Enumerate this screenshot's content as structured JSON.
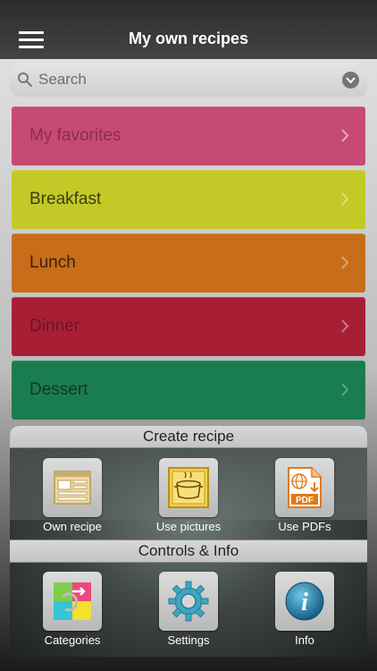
{
  "header": {
    "title": "My own recipes",
    "menu_icon": "hamburger-menu-icon"
  },
  "search": {
    "placeholder": "Search",
    "icon": "search-icon",
    "dropdown_icon": "chevron-down-circle-icon"
  },
  "categories": [
    {
      "label": "My favorites",
      "color": "#c74a74",
      "text_color": "#8a2d4f"
    },
    {
      "label": "Breakfast",
      "color": "#c3c926",
      "text_color": "#3d3d10"
    },
    {
      "label": "Lunch",
      "color": "#c86d1a",
      "text_color": "#3a2208"
    },
    {
      "label": "Dinner",
      "color": "#a81f35",
      "text_color": "#6e1222"
    },
    {
      "label": "Dessert",
      "color": "#1a7d4f",
      "text_color": "#0f3a25"
    }
  ],
  "create_section": {
    "title": "Create recipe",
    "items": [
      {
        "label": "Own recipe",
        "icon": "recipe-form-icon"
      },
      {
        "label": "Use pictures",
        "icon": "cooking-pot-icon"
      },
      {
        "label": "Use PDFs",
        "icon": "pdf-globe-icon"
      }
    ]
  },
  "controls_section": {
    "title": "Controls & Info",
    "items": [
      {
        "label": "Categories",
        "icon": "categories-grid-icon"
      },
      {
        "label": "Settings",
        "icon": "gear-icon"
      },
      {
        "label": "Info",
        "icon": "info-icon"
      }
    ]
  }
}
